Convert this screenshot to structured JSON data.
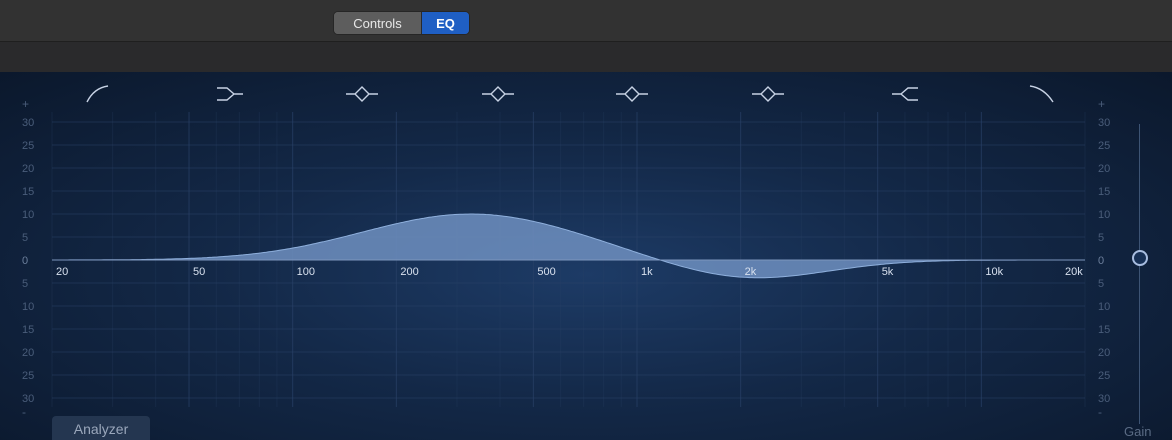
{
  "tabs": [
    {
      "label": "Controls",
      "active": false
    },
    {
      "label": "EQ",
      "active": true
    }
  ],
  "band_icons": [
    "low-cut-icon",
    "low-shelf-icon",
    "parametric-icon",
    "parametric-icon",
    "parametric-icon",
    "parametric-icon",
    "high-shelf-icon",
    "high-cut-icon"
  ],
  "db_scale": {
    "top_symbol": "+",
    "bottom_symbol": "-",
    "upper_labels": [
      "30",
      "25",
      "20",
      "15",
      "10",
      "5"
    ],
    "zero": "0",
    "lower_labels": [
      "5",
      "10",
      "15",
      "20",
      "25",
      "30"
    ]
  },
  "freq_labels": [
    "20",
    "50",
    "100",
    "200",
    "500",
    "1k",
    "2k",
    "5k",
    "10k",
    "20k"
  ],
  "analyzer_label": "Analyzer",
  "gain_label": "Gain",
  "gain_value_db": 0,
  "colors": {
    "accent": "#1f5fc4",
    "curve_fill": "#6e8fbf",
    "grid": "#2a4268",
    "panel_bg": "#132847"
  }
}
